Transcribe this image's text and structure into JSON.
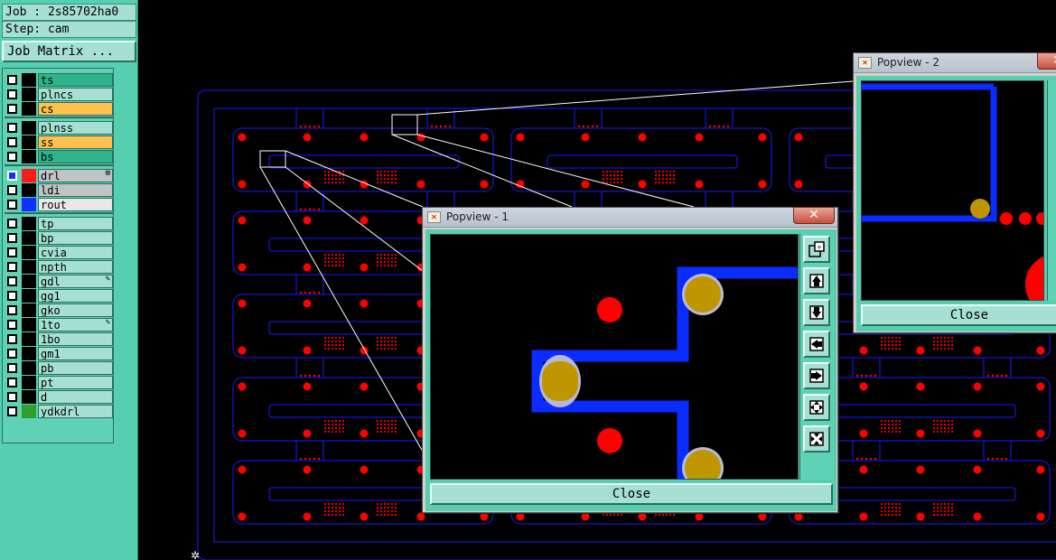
{
  "job": {
    "label": "Job : 2s85702ha0",
    "step": "Step: cam"
  },
  "job_matrix_button": "Job Matrix ...",
  "layers": [
    {
      "name": "ts",
      "row_color": "#2fb38b",
      "swatch": "#000000",
      "group": 0
    },
    {
      "name": "plncs",
      "row_color": "#a6e0d2",
      "swatch": "#000000",
      "group": 0
    },
    {
      "name": "cs",
      "row_color": "#ffc04d",
      "swatch": "#000000",
      "group": 0
    },
    {
      "name": "plnss",
      "row_color": "#a6e0d2",
      "swatch": "#000000",
      "group": 1
    },
    {
      "name": "ss",
      "row_color": "#ffc04d",
      "swatch": "#000000",
      "group": 1
    },
    {
      "name": "bs",
      "row_color": "#2fb38b",
      "swatch": "#000000",
      "group": 1
    },
    {
      "name": "drl",
      "row_color": "#bfc4c4",
      "swatch": "#ff1a1a",
      "group": 2,
      "active": true,
      "flag": "⊞"
    },
    {
      "name": "ldi",
      "row_color": "#bfc4c4",
      "swatch": "#000000",
      "group": 2
    },
    {
      "name": "rout",
      "row_color": "#e8e8e8",
      "swatch": "#1030ff",
      "group": 2
    },
    {
      "name": "tp",
      "row_color": "#a6e0d2",
      "swatch": "#000000",
      "group": 3
    },
    {
      "name": "bp",
      "row_color": "#a6e0d2",
      "swatch": "#000000",
      "group": 3
    },
    {
      "name": "cvia",
      "row_color": "#a6e0d2",
      "swatch": "#000000",
      "group": 3
    },
    {
      "name": "npth",
      "row_color": "#a6e0d2",
      "swatch": "#000000",
      "group": 3
    },
    {
      "name": "gdl",
      "row_color": "#a6e0d2",
      "swatch": "#000000",
      "group": 3,
      "flag": "✎"
    },
    {
      "name": "gg1",
      "row_color": "#a6e0d2",
      "swatch": "#000000",
      "group": 3
    },
    {
      "name": "gko",
      "row_color": "#a6e0d2",
      "swatch": "#000000",
      "group": 3
    },
    {
      "name": "1to",
      "row_color": "#a6e0d2",
      "swatch": "#000000",
      "group": 3,
      "flag": "✎"
    },
    {
      "name": "1bo",
      "row_color": "#a6e0d2",
      "swatch": "#000000",
      "group": 3
    },
    {
      "name": "gm1",
      "row_color": "#a6e0d2",
      "swatch": "#000000",
      "group": 3
    },
    {
      "name": "pb",
      "row_color": "#a6e0d2",
      "swatch": "#000000",
      "group": 3
    },
    {
      "name": "pt",
      "row_color": "#a6e0d2",
      "swatch": "#000000",
      "group": 3
    },
    {
      "name": "d",
      "row_color": "#a6e0d2",
      "swatch": "#000000",
      "group": 3
    },
    {
      "name": "ydkdrl",
      "row_color": "#a6e0d2",
      "swatch": "#2fa030",
      "group": 3
    }
  ],
  "popview1": {
    "title": "Popview - 1",
    "close_label": "Close",
    "close_x": "✕"
  },
  "popview2": {
    "title": "Popview - 2",
    "close_label": "Close",
    "close_x": "✕"
  },
  "colors": {
    "trace": "#0a2cff",
    "pad": "#bf9600",
    "pad_halo": "#b8b8d8",
    "drill": "#ff0000",
    "outline": "#1a1aff"
  }
}
